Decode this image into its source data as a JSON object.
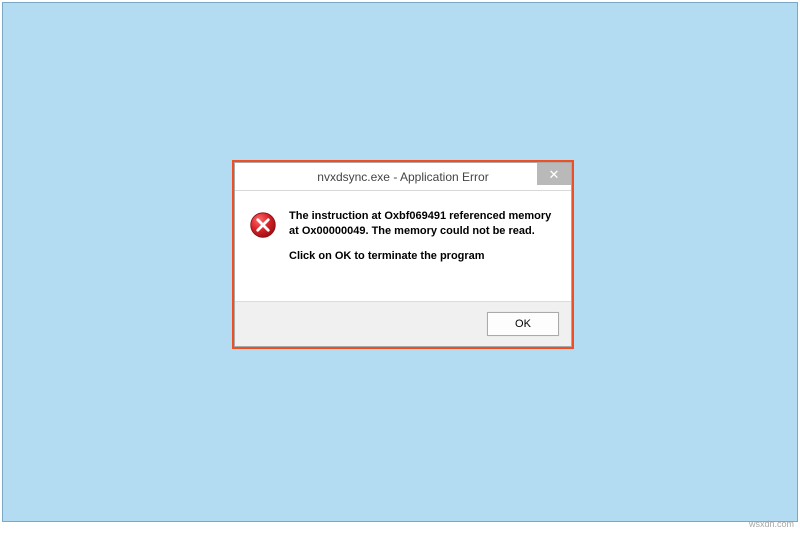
{
  "dialog": {
    "title": "nvxdsync.exe - Application Error",
    "close_glyph": "✕",
    "message_line1": "The instruction at Oxbf069491 referenced memory at Ox00000049. The memory could not be read.",
    "message_line2": "Click on OK to terminate the program",
    "ok_label": "OK"
  },
  "watermark": "wsxdn.com",
  "colors": {
    "backdrop": "#b3dcf2",
    "frame": "#f04e23",
    "close_bg": "#b9b9b9",
    "error_red": "#d62027"
  }
}
